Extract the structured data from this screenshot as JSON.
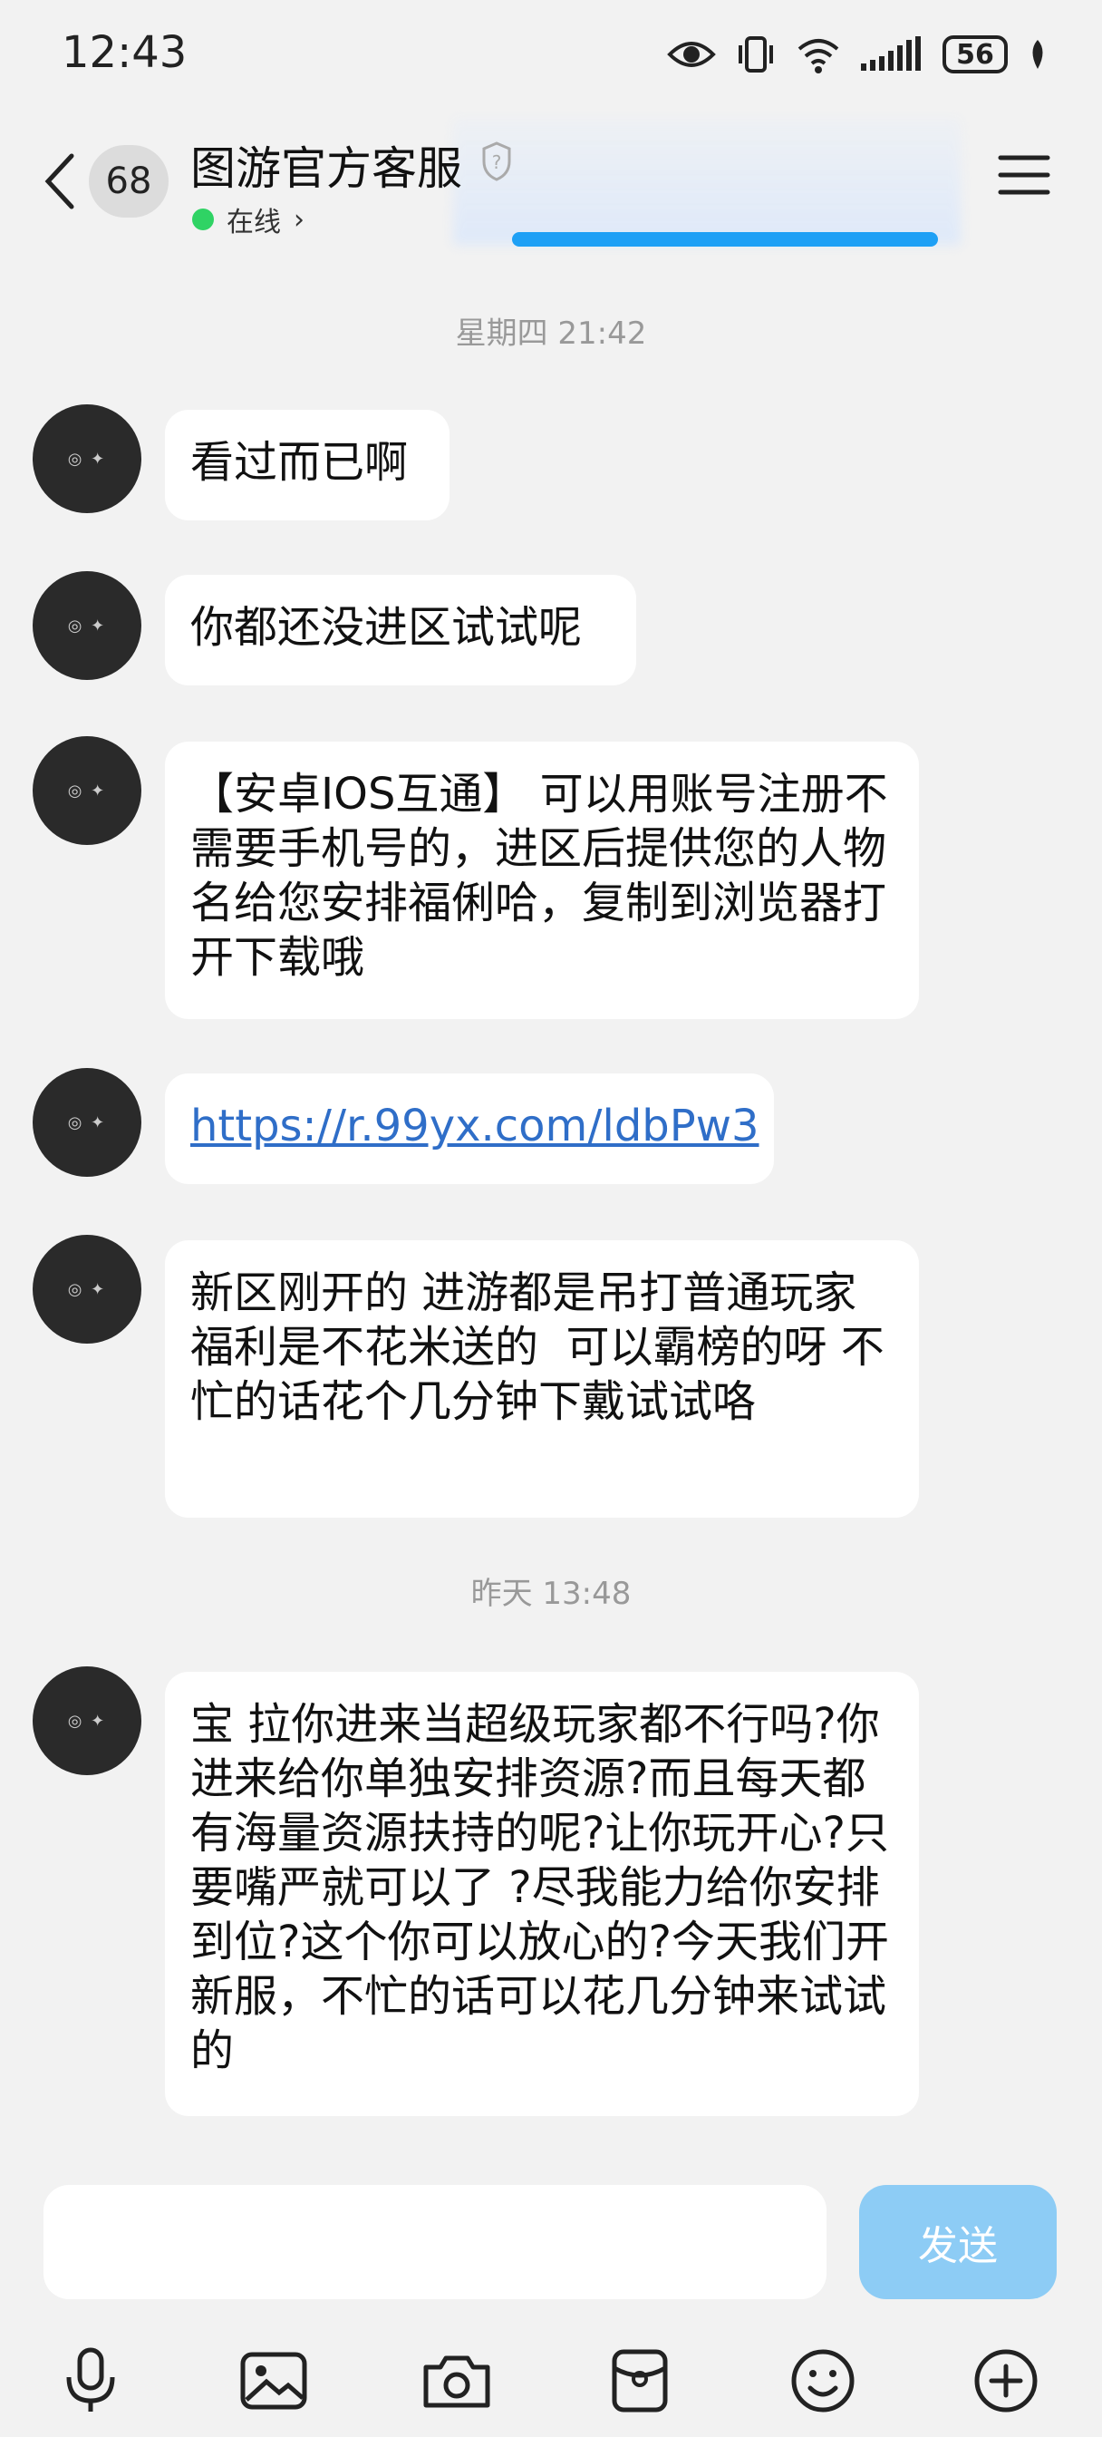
{
  "status_bar": {
    "time": "12:43",
    "battery": "56"
  },
  "header": {
    "unread_count": "68",
    "title": "图游官方客服",
    "status": "在线",
    "status_chevron": "›"
  },
  "messages": [
    {
      "type": "time",
      "text": "星期四 21:42"
    },
    {
      "type": "text",
      "text": "看过而已啊"
    },
    {
      "type": "text",
      "text": "你都还没进区试试呢"
    },
    {
      "type": "text",
      "text": "【安卓IOS互通】 可以用账号注册不需要手机号的，进区后提供您的人物名给您安排福俐哈，复制到浏览器打开下载哦"
    },
    {
      "type": "link",
      "text": "https://r.99yx.com/ldbPw3"
    },
    {
      "type": "text",
      "text": "新区刚开的 进游都是吊打普通玩家  福利是不花米送的  可以霸榜的呀 不忙的话花个几分钟下戴试试咯"
    },
    {
      "type": "time",
      "text": "昨天 13:48"
    },
    {
      "type": "text",
      "text": "宝 拉你进来当超级玩家都不行吗?你进来给你单独安排资源?而且每天都有海量资源扶持的呢?让你玩开心?只要嘴严就可以了 ?尽我能力给你安排到位?这个你可以放心的?今天我们开新服，不忙的话可以花几分钟来试试的"
    }
  ],
  "input": {
    "placeholder": "",
    "send_label": "发送"
  },
  "colors": {
    "online": "#2fd364",
    "link": "#2f6ec8",
    "send_button": "#8dccf5"
  },
  "toolbar_icons": [
    "microphone-icon",
    "image-icon",
    "camera-icon",
    "red-packet-icon",
    "emoji-icon",
    "plus-icon"
  ]
}
